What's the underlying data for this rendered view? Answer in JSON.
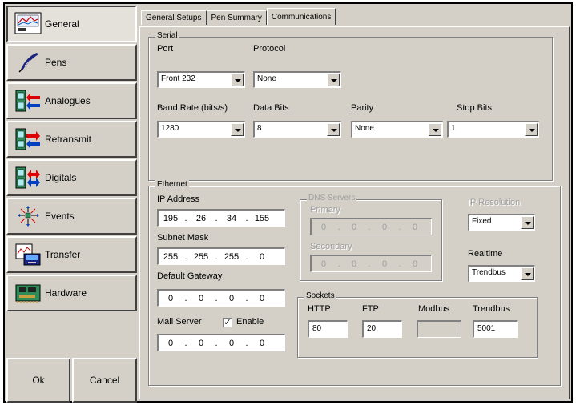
{
  "nav": {
    "items": [
      {
        "label": "General",
        "icon": "chart-recorder-icon",
        "active": true
      },
      {
        "label": "Pens",
        "icon": "quill-pen-icon"
      },
      {
        "label": "Analogues",
        "icon": "analogue-input-icon"
      },
      {
        "label": "Retransmit",
        "icon": "retransmit-icon"
      },
      {
        "label": "Digitals",
        "icon": "digital-io-icon"
      },
      {
        "label": "Events",
        "icon": "events-icon"
      },
      {
        "label": "Transfer",
        "icon": "transfer-icon"
      },
      {
        "label": "Hardware",
        "icon": "hardware-board-icon"
      }
    ],
    "ok_label": "Ok",
    "cancel_label": "Cancel"
  },
  "tabs": [
    {
      "label": "General Setups"
    },
    {
      "label": "Pen Summary"
    },
    {
      "label": "Communications",
      "active": true
    }
  ],
  "serial": {
    "title": "Serial",
    "port_label": "Port",
    "port_value": "Front 232",
    "protocol_label": "Protocol",
    "protocol_value": "None",
    "baud_label": "Baud Rate (bits/s)",
    "baud_value": "1280",
    "databits_label": "Data Bits",
    "databits_value": "8",
    "parity_label": "Parity",
    "parity_value": "None",
    "stopbits_label": "Stop Bits",
    "stopbits_value": "1"
  },
  "ethernet": {
    "title": "Ethernet",
    "ip_label": "IP Address",
    "ip": [
      "195",
      "26",
      "34",
      "155"
    ],
    "subnet_label": "Subnet Mask",
    "subnet": [
      "255",
      "255",
      "255",
      "0"
    ],
    "gateway_label": "Default Gateway",
    "gateway": [
      "0",
      "0",
      "0",
      "0"
    ],
    "mail_label": "Mail Server",
    "mail_enable_label": "Enable",
    "mail_enable_checked": true,
    "mail": [
      "0",
      "0",
      "0",
      "0"
    ],
    "dns_title": "DNS Servers",
    "dns_primary_label": "Primary",
    "dns_primary": [
      "0",
      "0",
      "0",
      "0"
    ],
    "dns_secondary_label": "Secondary",
    "dns_secondary": [
      "0",
      "0",
      "0",
      "0"
    ],
    "ipres_label": "IP Resolution",
    "ipres_value": "Fixed",
    "realtime_label": "Realtime",
    "realtime_value": "Trendbus",
    "sockets": {
      "title": "Sockets",
      "http_label": "HTTP",
      "http_value": "80",
      "ftp_label": "FTP",
      "ftp_value": "20",
      "modbus_label": "Modbus",
      "modbus_value": "",
      "trendbus_label": "Trendbus",
      "trendbus_value": "5001"
    }
  }
}
